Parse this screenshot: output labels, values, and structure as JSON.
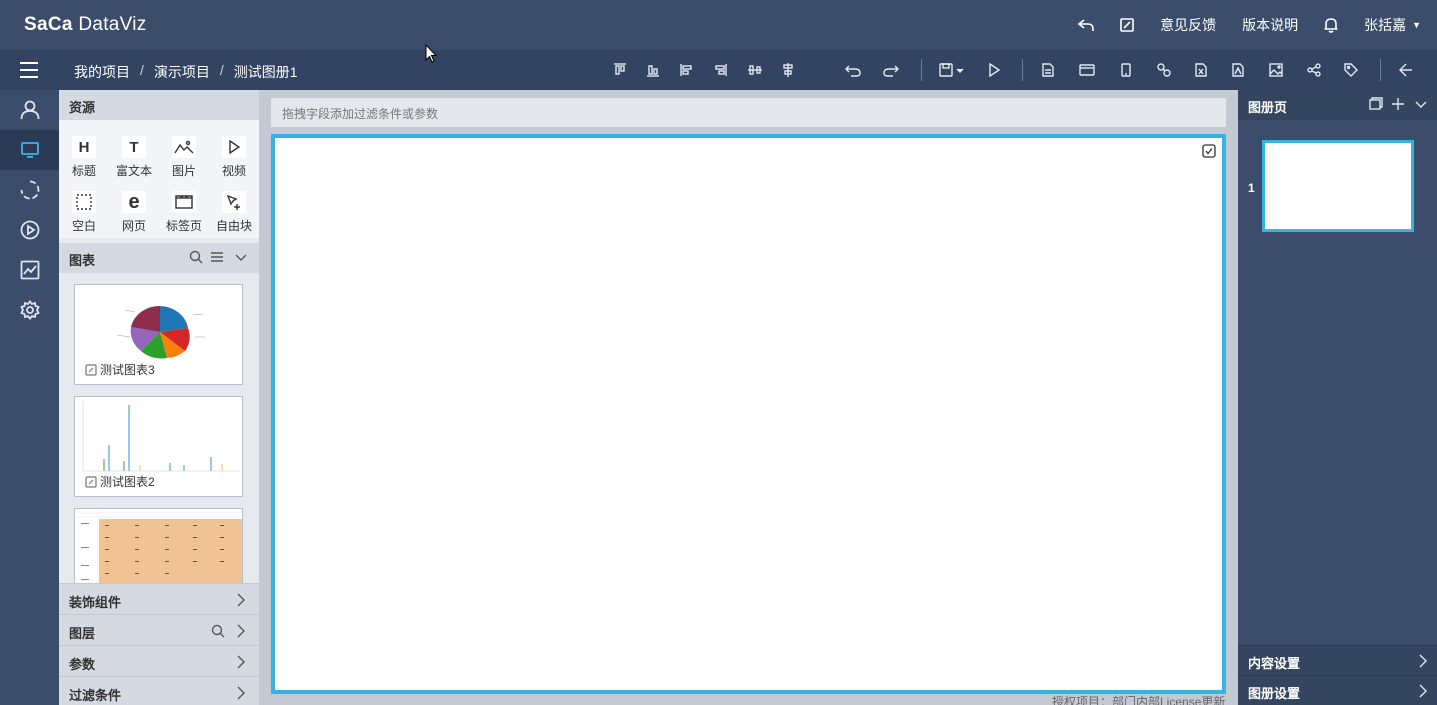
{
  "app": {
    "logo_a": "Sa",
    "logo_b": "Ca",
    "logo_c": " DataViz"
  },
  "header": {
    "feedback": "意见反馈",
    "version_notes": "版本说明",
    "user_name": "张括嘉"
  },
  "breadcrumb": [
    "我的项目",
    "演示项目",
    "测试图册1"
  ],
  "breadcrumb_sep": "/",
  "resources": {
    "title": "资源",
    "items": [
      {
        "label": "标题",
        "glyph": "H"
      },
      {
        "label": "富文本",
        "glyph": "T"
      },
      {
        "label": "图片",
        "glyph": ""
      },
      {
        "label": "视频",
        "glyph": ""
      },
      {
        "label": "空白",
        "glyph": ""
      },
      {
        "label": "网页",
        "glyph": "e"
      },
      {
        "label": "标签页",
        "glyph": ""
      },
      {
        "label": "自由块",
        "glyph": ""
      }
    ]
  },
  "charts": {
    "title": "图表",
    "cards": [
      {
        "name": "测试图表3",
        "kind": "pie"
      },
      {
        "name": "测试图表2",
        "kind": "bar"
      },
      {
        "name": "",
        "kind": "table"
      }
    ]
  },
  "sections": {
    "decor": "装饰组件",
    "layers": "图层",
    "params": "参数",
    "filters": "过滤条件"
  },
  "filterbar": {
    "placeholder": "拖拽字段添加过滤条件或参数"
  },
  "license_text": "授权项目：部门内部License更新",
  "right_panel": {
    "title": "图册页",
    "page_number": "1",
    "content_settings": "内容设置",
    "album_settings": "图册设置"
  },
  "colors": {
    "header_bg": "#3b4d6b",
    "navbar_bg": "#324462",
    "accent": "#36b3e3"
  }
}
